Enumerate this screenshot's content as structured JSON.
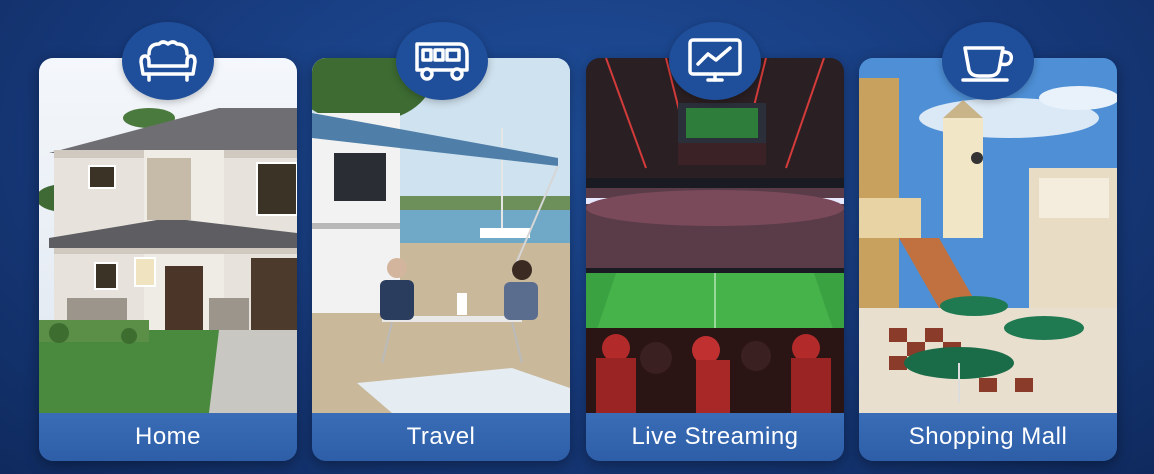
{
  "cards": [
    {
      "label": "Home",
      "icon": "sofa-icon"
    },
    {
      "label": "Travel",
      "icon": "rv-bus-icon"
    },
    {
      "label": "Live Streaming",
      "icon": "monitor-chart-icon"
    },
    {
      "label": "Shopping Mall",
      "icon": "coffee-cup-icon"
    }
  ],
  "colors": {
    "background": "#173a7c",
    "label_bar": "#2e5ea8",
    "badge": "#1f4e9a"
  }
}
